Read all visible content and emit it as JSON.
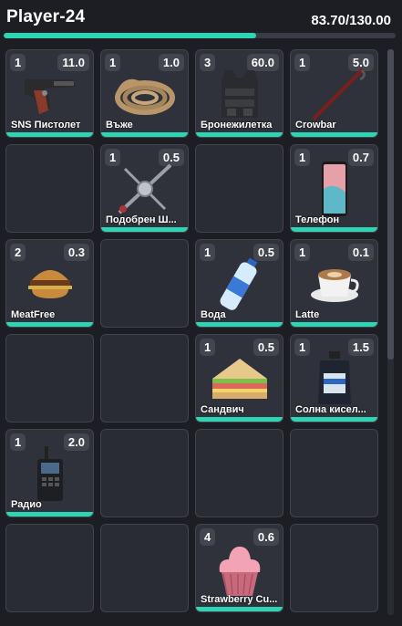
{
  "player": {
    "name": "Player-24",
    "weight_text": "83.70/130.00",
    "weight_fraction": 0.644
  },
  "accent_color": "#2fd4b4",
  "slots": [
    {
      "qty": "1",
      "weight": "11.0",
      "label": "SNS Пистолет",
      "icon": "pistol-icon"
    },
    {
      "qty": "1",
      "weight": "1.0",
      "label": "Въже",
      "icon": "rope-icon"
    },
    {
      "qty": "3",
      "weight": "60.0",
      "label": "Бронежилетка",
      "icon": "vest-icon"
    },
    {
      "qty": "1",
      "weight": "5.0",
      "label": "Crowbar",
      "icon": "crowbar-icon"
    },
    {},
    {
      "qty": "1",
      "weight": "0.5",
      "label": "Подобрен Ш...",
      "icon": "lockpick-icon"
    },
    {},
    {
      "qty": "1",
      "weight": "0.7",
      "label": "Телефон",
      "icon": "phone-icon"
    },
    {
      "qty": "2",
      "weight": "0.3",
      "label": "MeatFree",
      "icon": "burger-icon"
    },
    {},
    {
      "qty": "1",
      "weight": "0.5",
      "label": "Вода",
      "icon": "water-bottle-icon"
    },
    {
      "qty": "1",
      "weight": "0.1",
      "label": "Latte",
      "icon": "coffee-icon"
    },
    {},
    {},
    {
      "qty": "1",
      "weight": "0.5",
      "label": "Сандвич",
      "icon": "sandwich-icon"
    },
    {
      "qty": "1",
      "weight": "1.5",
      "label": "Солна кисел...",
      "icon": "acid-jug-icon"
    },
    {
      "qty": "1",
      "weight": "2.0",
      "label": "Радио",
      "icon": "radio-icon"
    },
    {},
    {},
    {},
    {},
    {},
    {
      "qty": "4",
      "weight": "0.6",
      "label": "Strawberry Cu...",
      "icon": "cupcake-icon"
    },
    {}
  ]
}
